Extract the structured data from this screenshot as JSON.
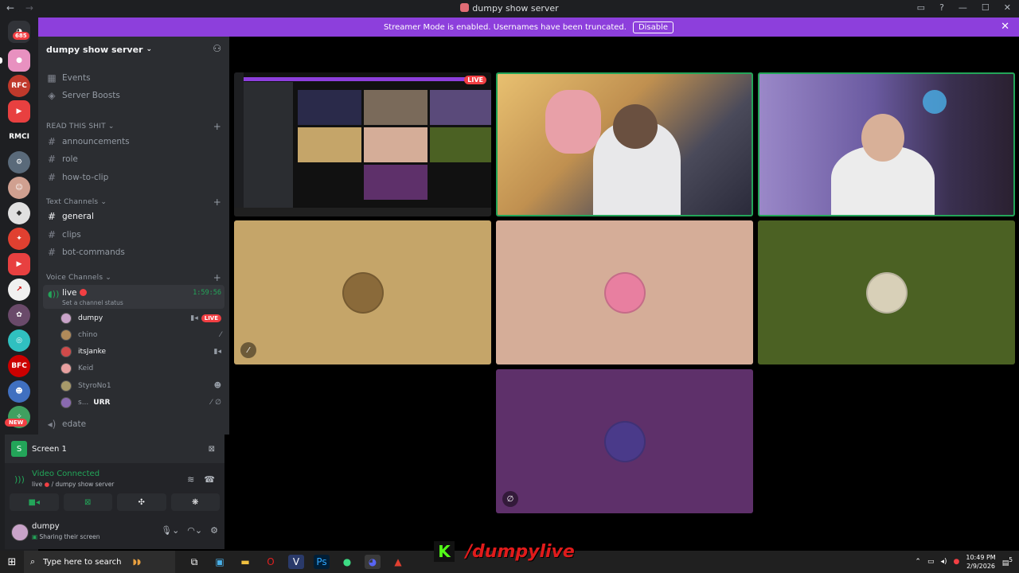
{
  "window": {
    "title": "dumpy show server",
    "nav_back": "←",
    "nav_fwd": "→"
  },
  "banner": {
    "text": "Streamer Mode is enabled. Usernames have been truncated.",
    "button": "Disable"
  },
  "guild_bar": {
    "dm_badge": "685",
    "labels": [
      "RMCI",
      "NEW"
    ]
  },
  "server": {
    "name": "dumpy show server"
  },
  "sidebar": {
    "top_items": [
      {
        "label": "Events"
      },
      {
        "label": "Server Boosts"
      }
    ],
    "categories": {
      "read": "READ THIS SHIT",
      "text": "Text Channels",
      "voice": "Voice Channels"
    },
    "read_channels": [
      "announcements",
      "role",
      "how-to-clip"
    ],
    "text_channels": [
      "general",
      "clips",
      "bot-commands"
    ],
    "voice_channel": {
      "name": "live",
      "status": "Set a channel status",
      "timer": "1:59:56"
    },
    "voice_users": [
      {
        "name": "dumpy",
        "badge": "LIVE",
        "color": "#c9a3c9"
      },
      {
        "name": "chino",
        "color": "#b08a5a"
      },
      {
        "name": "itsJanke",
        "color": "#d04a4a"
      },
      {
        "name": "Keid",
        "color": "#e8a0a0"
      },
      {
        "name": "StyroNo1",
        "color": "#a89a6a"
      },
      {
        "name": "s...",
        "extra": "URR",
        "color": "#8a6ab0"
      }
    ],
    "other_voice": "edate"
  },
  "panel": {
    "screen_title": "Screen 1",
    "vc_status": "Video Connected",
    "vc_channel": "live",
    "vc_server": "/ dumpy show server",
    "user_name": "dumpy",
    "user_status": "Sharing their screen"
  },
  "stage": {
    "live_badge": "LIVE",
    "tiles": [
      {
        "bg": "#c5a569",
        "avatar": "#8a6a3a"
      },
      {
        "bg": "#d5ad98",
        "avatar": "#e87fa0"
      },
      {
        "bg": "#4b6123",
        "avatar": "#d8d0b8"
      },
      {
        "bg": "#5e306a",
        "avatar": "#4a3a8a"
      }
    ]
  },
  "taskbar": {
    "search_placeholder": "Type here to search",
    "time": "10:49 PM",
    "date": "2/9/2026",
    "notif": "5"
  },
  "watermark": {
    "logo": "K",
    "text": "/dumpylive"
  }
}
